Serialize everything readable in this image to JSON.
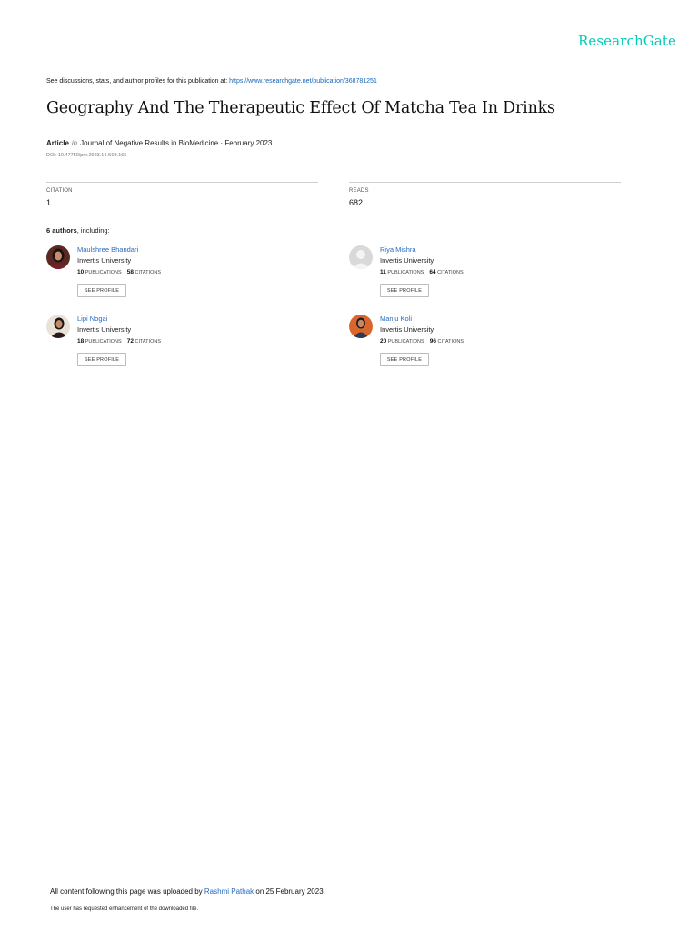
{
  "brand": {
    "logo_text": "ResearchGate",
    "accent_color": "#00ccbb",
    "link_color": "#2a6bc1"
  },
  "header": {
    "note_prefix": "See discussions, stats, and author profiles for this publication at: ",
    "note_url": "https://www.researchgate.net/publication/368781251"
  },
  "publication": {
    "title": "Geography And The Therapeutic Effect Of Matcha Tea In Drinks",
    "type": "Article",
    "in_word": "in",
    "journal": "Journal of Negative Results in BioMedicine · February 2023",
    "doi": "DOI: 10.47750/pnr.2023.14.S03.165"
  },
  "stats": {
    "citation_label": "CITATION",
    "citation_value": "1",
    "reads_label": "READS",
    "reads_value": "682"
  },
  "authors_section": {
    "count": "6 authors",
    "suffix": ", including:"
  },
  "authors": [
    {
      "name": "Maulshree Bhandari",
      "institution": "Invertis University",
      "publications": "10",
      "publications_label": "PUBLICATIONS",
      "citations": "58",
      "citations_label": "CITATIONS",
      "button_label": "SEE PROFILE",
      "avatar_icon": "profile-photo-icon"
    },
    {
      "name": "Riya Mishra",
      "institution": "Invertis University",
      "publications": "11",
      "publications_label": "PUBLICATIONS",
      "citations": "64",
      "citations_label": "CITATIONS",
      "button_label": "SEE PROFILE",
      "avatar_icon": "default-avatar-icon"
    },
    {
      "name": "Lipi Nogai",
      "institution": "Invertis University",
      "publications": "18",
      "publications_label": "PUBLICATIONS",
      "citations": "72",
      "citations_label": "CITATIONS",
      "button_label": "SEE PROFILE",
      "avatar_icon": "profile-photo-icon"
    },
    {
      "name": "Manju Koli",
      "institution": "Invertis University",
      "publications": "20",
      "publications_label": "PUBLICATIONS",
      "citations": "96",
      "citations_label": "CITATIONS",
      "button_label": "SEE PROFILE",
      "avatar_icon": "profile-photo-icon"
    }
  ],
  "footer": {
    "upload_prefix": "All content following this page was uploaded by ",
    "uploader": "Rashmi Pathak",
    "upload_suffix": " on 25 February 2023.",
    "enhancement_note": "The user has requested enhancement of the downloaded file."
  }
}
